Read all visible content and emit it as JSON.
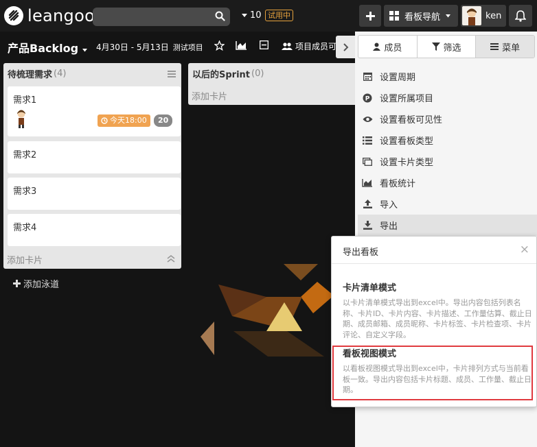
{
  "topbar": {
    "logo_text": "leangoo",
    "search_placeholder": "",
    "count": "10",
    "trial": "试用中",
    "nav_label": "看板导航",
    "user_name": "ken"
  },
  "board": {
    "title": "产品Backlog",
    "dates": "4月30日 - 5月13日",
    "project": "测试项目",
    "members_label": "项目成员可"
  },
  "lists": [
    {
      "title": "待梳理需求",
      "count": "(4)",
      "cards": [
        {
          "title": "需求1",
          "due": "今天18:00",
          "comments": "20"
        },
        {
          "title": "需求2"
        },
        {
          "title": "需求3"
        },
        {
          "title": "需求4"
        }
      ],
      "add_card": "添加卡片"
    },
    {
      "title": "以后的Sprint",
      "count": "(0)",
      "add_card": "添加卡片"
    }
  ],
  "add_swimlane": "添加泳道",
  "panel": {
    "tabs": [
      "成员",
      "筛选",
      "菜单"
    ],
    "items": [
      "设置周期",
      "设置所属项目",
      "设置看板可见性",
      "设置看板类型",
      "设置卡片类型",
      "看板统计",
      "导入",
      "导出"
    ]
  },
  "export": {
    "title": "导出看板",
    "close": "×",
    "options": [
      {
        "title": "卡片清单模式",
        "desc": "以卡片清单模式导出到excel中。导出内容包括列表名称、卡片ID、卡片内容、卡片描述、工作量估算、截止日期、成员邮箱、成员昵称、卡片标签、卡片检查项、卡片评论、自定义字段。"
      },
      {
        "title": "看板视图模式",
        "desc": "以看板视图模式导出到excel中，卡片排列方式与当前看板一致。导出内容包括卡片标题、成员、工作量、截止日期。"
      }
    ]
  },
  "colors": {
    "accent": "#e0393e",
    "due": "#f0a351",
    "topbar": "#1b1b1b"
  }
}
